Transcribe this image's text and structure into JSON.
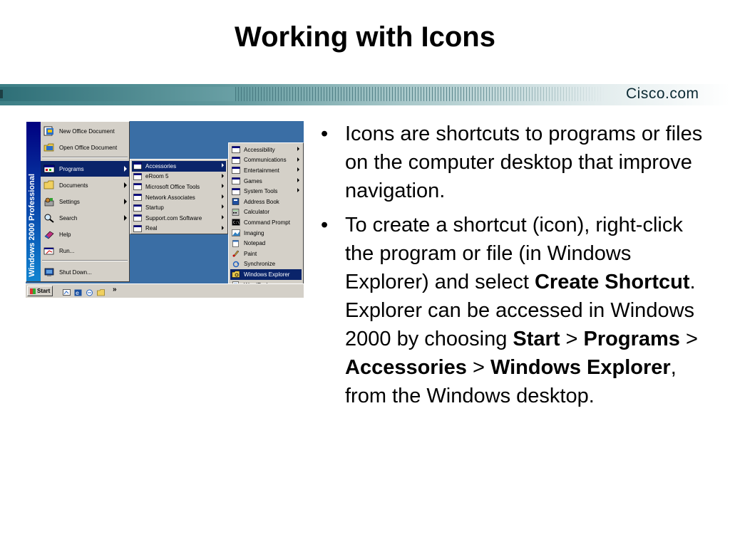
{
  "title": "Working with Icons",
  "banner": {
    "brand": "Cisco.com"
  },
  "screenshot": {
    "vertical_label": "Windows 2000 Professional",
    "start_menu": [
      {
        "label": "New Office Document",
        "icon": "office-doc-icon"
      },
      {
        "label": "Open Office Document",
        "icon": "open-folder-icon"
      },
      {
        "label": "Programs",
        "icon": "programs-icon"
      },
      {
        "label": "Documents",
        "icon": "documents-icon"
      },
      {
        "label": "Settings",
        "icon": "settings-icon"
      },
      {
        "label": "Search",
        "icon": "search-icon"
      },
      {
        "label": "Help",
        "icon": "help-icon"
      },
      {
        "label": "Run...",
        "icon": "run-icon"
      },
      {
        "label": "Shut Down...",
        "icon": "shutdown-icon"
      }
    ],
    "programs_menu": [
      {
        "label": "Accessories"
      },
      {
        "label": "eRoom 5"
      },
      {
        "label": "Microsoft Office Tools"
      },
      {
        "label": "Network Associates"
      },
      {
        "label": "Startup"
      },
      {
        "label": "Support.com Software"
      },
      {
        "label": "Real"
      }
    ],
    "accessories_menu": [
      {
        "label": "Accessibility"
      },
      {
        "label": "Communications"
      },
      {
        "label": "Entertainment"
      },
      {
        "label": "Games"
      },
      {
        "label": "System Tools"
      },
      {
        "label": "Address Book"
      },
      {
        "label": "Calculator"
      },
      {
        "label": "Command Prompt"
      },
      {
        "label": "Imaging"
      },
      {
        "label": "Notepad"
      },
      {
        "label": "Paint"
      },
      {
        "label": "Synchronize"
      },
      {
        "label": "Windows Explorer"
      },
      {
        "label": "WordPad"
      }
    ],
    "taskbar": {
      "start_label": "Start",
      "chevron": "»"
    }
  },
  "bullets": {
    "b1": "Icons are shortcuts to programs or files on the computer desktop that improve navigation.",
    "b2_text1": "To create a shortcut (icon), right-click the program or file (in Windows Explorer) and select ",
    "b2_bold1": "Create Shortcut",
    "b2_text2": ". Explorer can be accessed in Windows 2000 by choosing ",
    "b2_bold2": "Start",
    "b2_sep1": " > ",
    "b2_bold3": "Programs",
    "b2_sep2": " > ",
    "b2_bold4": "Accessories",
    "b2_sep3": " > ",
    "b2_bold5": "Windows Explorer",
    "b2_text3": ", from the Windows desktop."
  },
  "colors": {
    "menu_highlight": "#0a246a",
    "desktop": "#3a6ea5",
    "menu_bg": "#d4d0c8",
    "banner_teal": "#3d7f86"
  }
}
